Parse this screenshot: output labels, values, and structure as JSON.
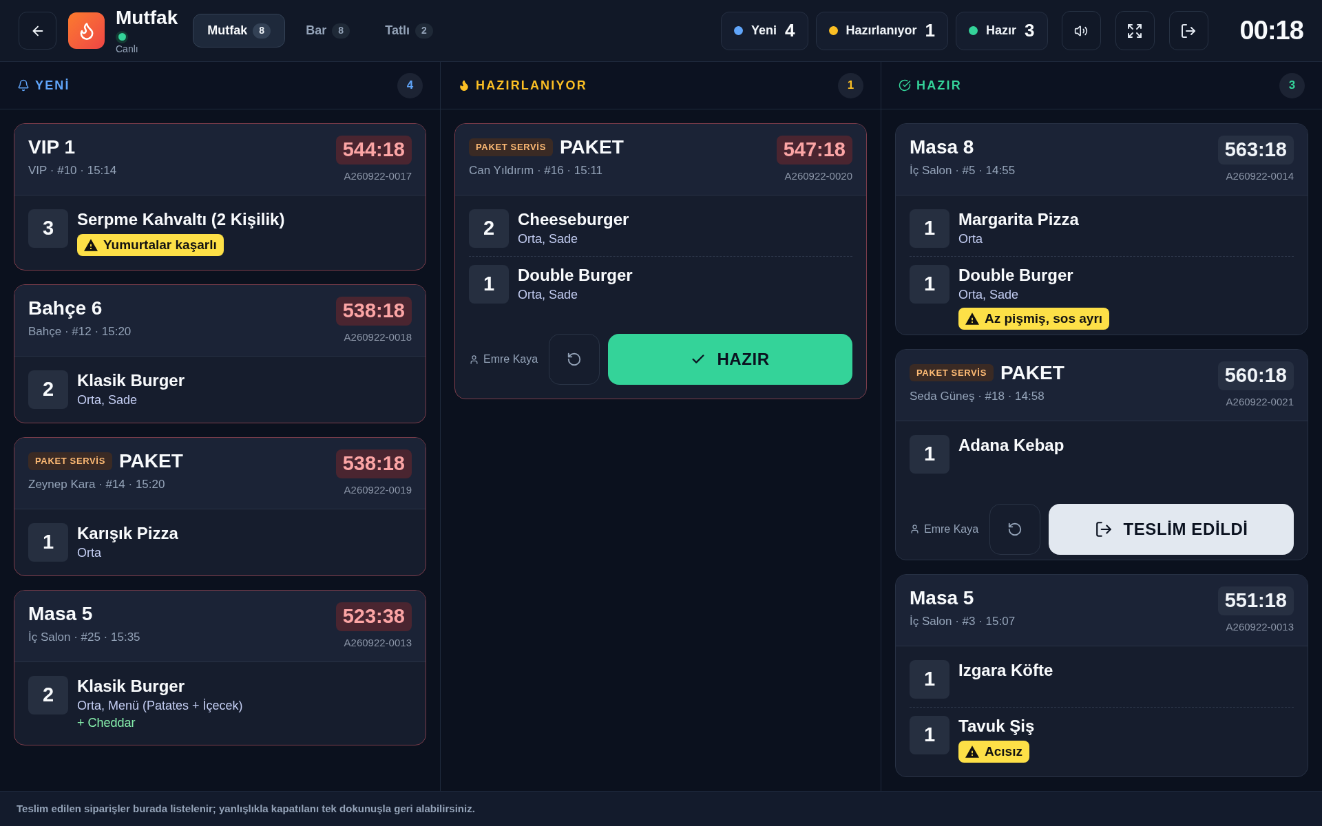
{
  "header": {
    "title": "Mutfak",
    "status": "Canlı",
    "stations": [
      {
        "label": "Mutfak",
        "count": "8",
        "selected": true
      },
      {
        "label": "Bar",
        "count": "8",
        "selected": false
      },
      {
        "label": "Tatlı",
        "count": "2",
        "selected": false
      }
    ],
    "status_summary": [
      {
        "label": "Yeni",
        "count": "4",
        "color": "#60a5fa"
      },
      {
        "label": "Hazırlanıyor",
        "count": "1",
        "color": "#fbbf24"
      },
      {
        "label": "Hazır",
        "count": "3",
        "color": "#34d399"
      }
    ],
    "clock": "00:18"
  },
  "columns": [
    {
      "kind": "new",
      "title": "YENİ",
      "count": "4",
      "color": "#60a5fa",
      "orders": [
        {
          "title": "VIP 1",
          "meta": "VIP · #10 · 15:14",
          "timer": "544:18",
          "order_no": "A260922-0017",
          "overdue": true,
          "items": [
            {
              "qty": "3",
              "name": "Serpme Kahvaltı (2 Kişilik)",
              "note": "Yumurtalar kaşarlı"
            }
          ]
        },
        {
          "title": "Bahçe 6",
          "meta": "Bahçe · #12 · 15:20",
          "timer": "538:18",
          "order_no": "A260922-0018",
          "overdue": true,
          "items": [
            {
              "qty": "2",
              "name": "Klasik Burger",
              "options": "Orta, Sade"
            }
          ]
        },
        {
          "service": "PAKET SERVİS",
          "title": "PAKET",
          "meta": "Zeynep Kara · #14 · 15:20",
          "timer": "538:18",
          "order_no": "A260922-0019",
          "overdue": true,
          "items": [
            {
              "qty": "1",
              "name": "Karışık Pizza",
              "options": "Orta"
            }
          ]
        },
        {
          "title": "Masa 5",
          "meta": "İç Salon · #25 · 15:35",
          "timer": "523:38",
          "order_no": "A260922-0013",
          "overdue": true,
          "items": [
            {
              "qty": "2",
              "name": "Klasik Burger",
              "options": "Orta, Menü (Patates + İçecek)",
              "extra": "+ Cheddar"
            }
          ]
        }
      ]
    },
    {
      "kind": "preparing",
      "title": "HAZIRLANIYOR",
      "count": "1",
      "color": "#fbbf24",
      "orders": [
        {
          "service": "PAKET SERVİS",
          "title": "PAKET",
          "meta": "Can Yıldırım · #16 · 15:11",
          "timer": "547:18",
          "order_no": "A260922-0020",
          "overdue": true,
          "items": [
            {
              "qty": "2",
              "name": "Cheeseburger",
              "options": "Orta, Sade"
            },
            {
              "qty": "1",
              "name": "Double Burger",
              "options": "Orta, Sade"
            }
          ],
          "waiter": "Emre Kaya",
          "action": {
            "kind": "ready",
            "label": "HAZIR"
          }
        }
      ]
    },
    {
      "kind": "ready",
      "title": "HAZIR",
      "count": "3",
      "color": "#34d399",
      "orders": [
        {
          "title": "Masa 8",
          "meta": "İç Salon · #5 · 14:55",
          "timer": "563:18",
          "order_no": "A260922-0014",
          "overdue": false,
          "items": [
            {
              "qty": "1",
              "name": "Margarita Pizza",
              "options": "Orta"
            },
            {
              "qty": "1",
              "name": "Double Burger",
              "options": "Orta, Sade",
              "note": "Az pişmiş, sos ayrı"
            }
          ]
        },
        {
          "service": "PAKET SERVİS",
          "title": "PAKET",
          "meta": "Seda Güneş · #18 · 14:58",
          "timer": "560:18",
          "order_no": "A260922-0021",
          "overdue": false,
          "items": [
            {
              "qty": "1",
              "name": "Adana Kebap"
            }
          ],
          "waiter": "Emre Kaya",
          "action": {
            "kind": "deliver",
            "label": "TESLİM EDİLDİ"
          }
        },
        {
          "title": "Masa 5",
          "meta": "İç Salon · #3 · 15:07",
          "timer": "551:18",
          "order_no": "A260922-0013",
          "overdue": false,
          "items": [
            {
              "qty": "1",
              "name": "Izgara Köfte"
            },
            {
              "qty": "1",
              "name": "Tavuk Şiş",
              "note": "Acısız"
            }
          ]
        }
      ]
    }
  ],
  "footer_note": "Teslim edilen siparişler burada listelenir; yanlışlıkla kapatılanı tek dokunuşla geri alabilirsiniz."
}
